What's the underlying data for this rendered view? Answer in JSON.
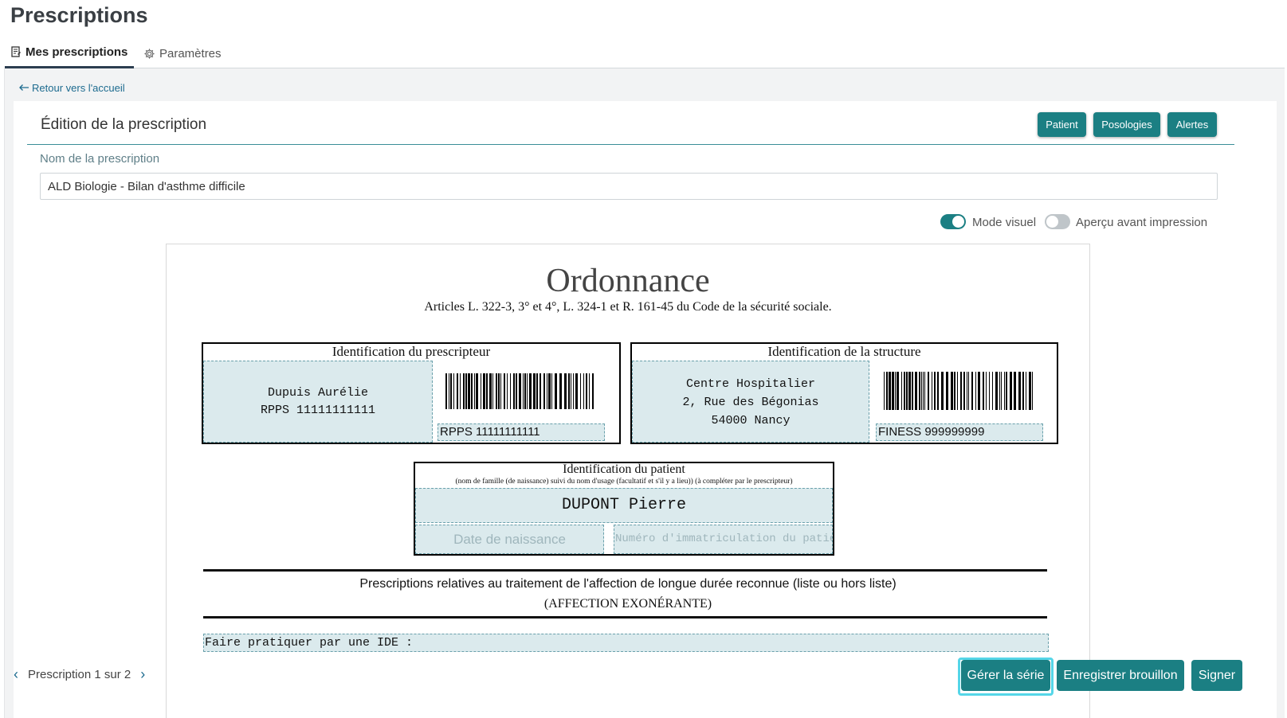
{
  "header": {
    "title": "Prescriptions",
    "tabs": [
      {
        "label": "Mes prescriptions",
        "active": true,
        "icon": "document-icon"
      },
      {
        "label": "Paramètres",
        "active": false,
        "icon": "gear-icon"
      }
    ]
  },
  "nav": {
    "back_label": "Retour vers l'accueil"
  },
  "editor": {
    "title": "Édition de la prescription",
    "buttons": {
      "patient": "Patient",
      "posologies": "Posologies",
      "alertes": "Alertes"
    },
    "name_label": "Nom de la prescription",
    "name_value": "ALD Biologie - Bilan d'asthme difficile",
    "toggles": {
      "visual": {
        "label": "Mode visuel",
        "on": true
      },
      "preview": {
        "label": "Aperçu avant impression",
        "on": false
      }
    }
  },
  "ordonnance": {
    "title": "Ordonnance",
    "subtitle": "Articles L. 322-3, 3° et 4°, L. 324-1 et R. 161-45 du Code de la sécurité sociale.",
    "prescriber": {
      "heading": "Identification du prescripteur",
      "name": "Dupuis Aurélie",
      "rpps": "RPPS 11111111111",
      "barcode_label": "RPPS 11111111111"
    },
    "structure": {
      "heading": "Identification de la structure",
      "line1": "Centre Hospitalier",
      "line2": "2, Rue des Bégonias",
      "line3": "54000 Nancy",
      "barcode_label": "FINESS 999999999"
    },
    "patient": {
      "heading": "Identification du patient",
      "subheading": "(nom de famille (de naissance) suivi du nom d'usage (facultatif et s'il y a lieu)) (à compléter par le prescripteur)",
      "name": "DUPONT Pierre",
      "birthdate_placeholder": "Date de naissance",
      "immat_placeholder": "Numéro d'immatriculation du patient"
    },
    "ald_heading": "Prescriptions relatives au traitement de l'affection de longue durée reconnue (liste ou hors liste)",
    "ald_subheading": "(AFFECTION EXONÉRANTE)",
    "ald_line": "Faire pratiquer par une IDE :"
  },
  "footer": {
    "pager_text": "Prescription 1 sur 2",
    "actions": {
      "serie": "Gérer la série",
      "draft": "Enregistrer brouillon",
      "sign": "Signer"
    }
  },
  "colors": {
    "accent": "#1b7f83",
    "fill": "#dbeaed",
    "focus": "#55d6e8",
    "link": "#1d6b8f"
  }
}
